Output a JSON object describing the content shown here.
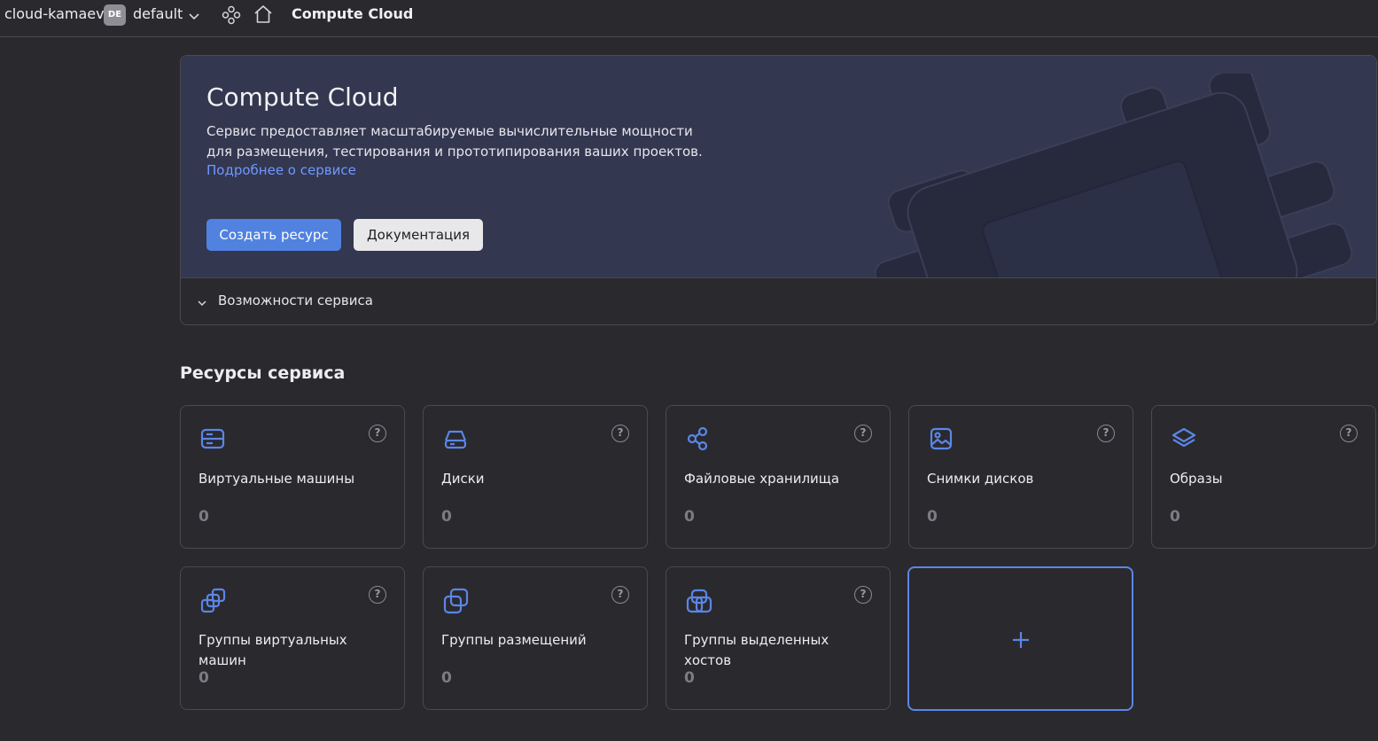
{
  "topbar": {
    "cloud_name": "cloud-kamaev",
    "folder_badge": "DE",
    "folder_name": "default",
    "service_title": "Compute Cloud"
  },
  "hero": {
    "title": "Compute Cloud",
    "description": "Сервис предоставляет масштабируемые вычислительные мощности для размещения, тестирования и прототипирования ваших проектов.",
    "link": "Подробнее о сервисе",
    "create_button": "Создать ресурс",
    "docs_button": "Документация",
    "features_label": "Возможности сервиса"
  },
  "resources": {
    "title": "Ресурсы сервиса",
    "help_glyph": "?",
    "add_glyph": "+",
    "cards": [
      {
        "label": "Виртуальные машины",
        "count": "0",
        "icon": "server-icon"
      },
      {
        "label": "Диски",
        "count": "0",
        "icon": "disk-icon"
      },
      {
        "label": "Файловые хранилища",
        "count": "0",
        "icon": "share-nodes-icon"
      },
      {
        "label": "Снимки дисков",
        "count": "0",
        "icon": "image-icon"
      },
      {
        "label": "Образы",
        "count": "0",
        "icon": "layers-icon"
      },
      {
        "label": "Группы виртуальных машин",
        "count": "0",
        "icon": "instance-group-icon"
      },
      {
        "label": "Группы размещений",
        "count": "0",
        "icon": "placement-group-icon"
      },
      {
        "label": "Группы выделенных хостов",
        "count": "0",
        "icon": "host-group-icon"
      }
    ]
  },
  "colors": {
    "background": "#2a292e",
    "hero_background": "#333750",
    "accent": "#5182e0",
    "link": "#6f98ff",
    "icon_blue": "#5b86e6"
  }
}
